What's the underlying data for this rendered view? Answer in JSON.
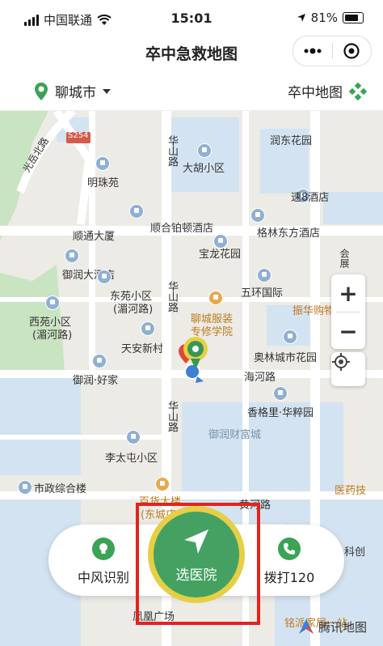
{
  "status_bar": {
    "carrier": "中国联通",
    "time": "15:01",
    "battery": "81%"
  },
  "nav": {
    "title": "卒中急救地图"
  },
  "city_bar": {
    "city": "聊城市",
    "map_link": "卒中地图"
  },
  "map": {
    "labels": {
      "s254": "S254",
      "huashan_top": "华山路",
      "runnong": "润东花园",
      "dahu": "大胡小区",
      "mingzhu": "明珠苑",
      "su8": "速8酒店",
      "shuntong": "顺通大厦",
      "shunhe": "顺合铂顿酒店",
      "gelin": "格林东方酒店",
      "guangyue": "光岳北路",
      "baolong": "宝龙花园",
      "yurun_hotel": "御润大酒店",
      "huizhan": "会展",
      "dongyuan": "东苑小区",
      "dongyuan2": "(湄河路)",
      "wuhuan": "五环国际",
      "huashan_mid": "华山路",
      "zhenhua": "振华购物",
      "xiyuan": "西苑小区",
      "xiyuan2": "(湄河路)",
      "liaocheng_school1": "聊城服装",
      "liaocheng_school2": "专修学院",
      "tianan": "天安新村",
      "aoti": "奥林城市花园",
      "yurun_haojia": "御润·好家",
      "haihe": "海河路",
      "xiangge": "香格里·华粹园",
      "huashan_low": "华山路",
      "yurun_caifu": "御润财富城",
      "litai": "李太屯小区",
      "shizheng": "市政综合楼",
      "baihuo": "百货大楼",
      "dongcheng": "(东城店)",
      "yaodian": "医药技",
      "huanghe": "黄河路",
      "kejian": "科创",
      "fenghuang": "凤凰广场",
      "mingpai": "铭派家居一站"
    },
    "zoom_in": "+",
    "zoom_out": "−"
  },
  "actions": {
    "stroke_id": "中风识别",
    "select_hospital": "选医院",
    "call_120": "拨打120"
  },
  "tencent_map": "腾讯地图",
  "colors": {
    "primary_green": "#44a161",
    "ring_yellow": "#e6cf44",
    "highlight_red": "#e3231f"
  },
  "icons": [
    "signal-icon",
    "wifi-icon",
    "location-arrow-icon",
    "battery-icon",
    "more-dots-icon",
    "target-icon",
    "location-pin-icon",
    "chevron-down-icon",
    "map-diamonds-icon",
    "plus-icon",
    "minus-icon",
    "locate-icon",
    "lightbulb-icon",
    "navigate-arrow-icon",
    "phone-icon",
    "tencent-logo-icon"
  ]
}
